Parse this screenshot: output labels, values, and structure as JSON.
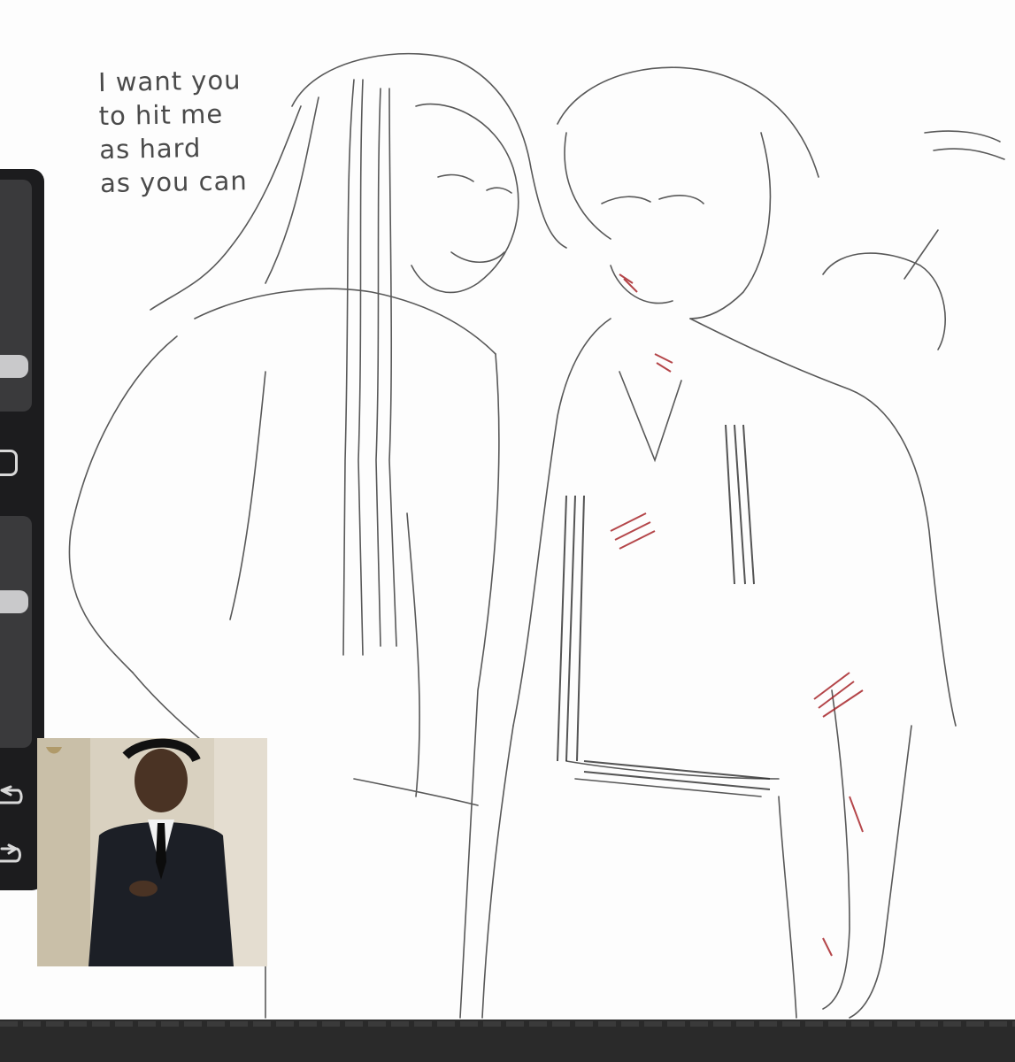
{
  "caption": {
    "lines": [
      "I want you",
      "to hit me",
      "as hard",
      "as you can"
    ]
  },
  "toolbar": {
    "brush_size": 0.3,
    "opacity": 0.5,
    "modify_button_icon": "square-icon",
    "undo_icon": "undo-icon",
    "redo_icon": "redo-icon"
  },
  "colors": {
    "sidebar": "#1c1c1e",
    "sketch_line": "#3c3c3c",
    "blood": "#a8262a",
    "bottom_bar": "#2a2a2a"
  }
}
